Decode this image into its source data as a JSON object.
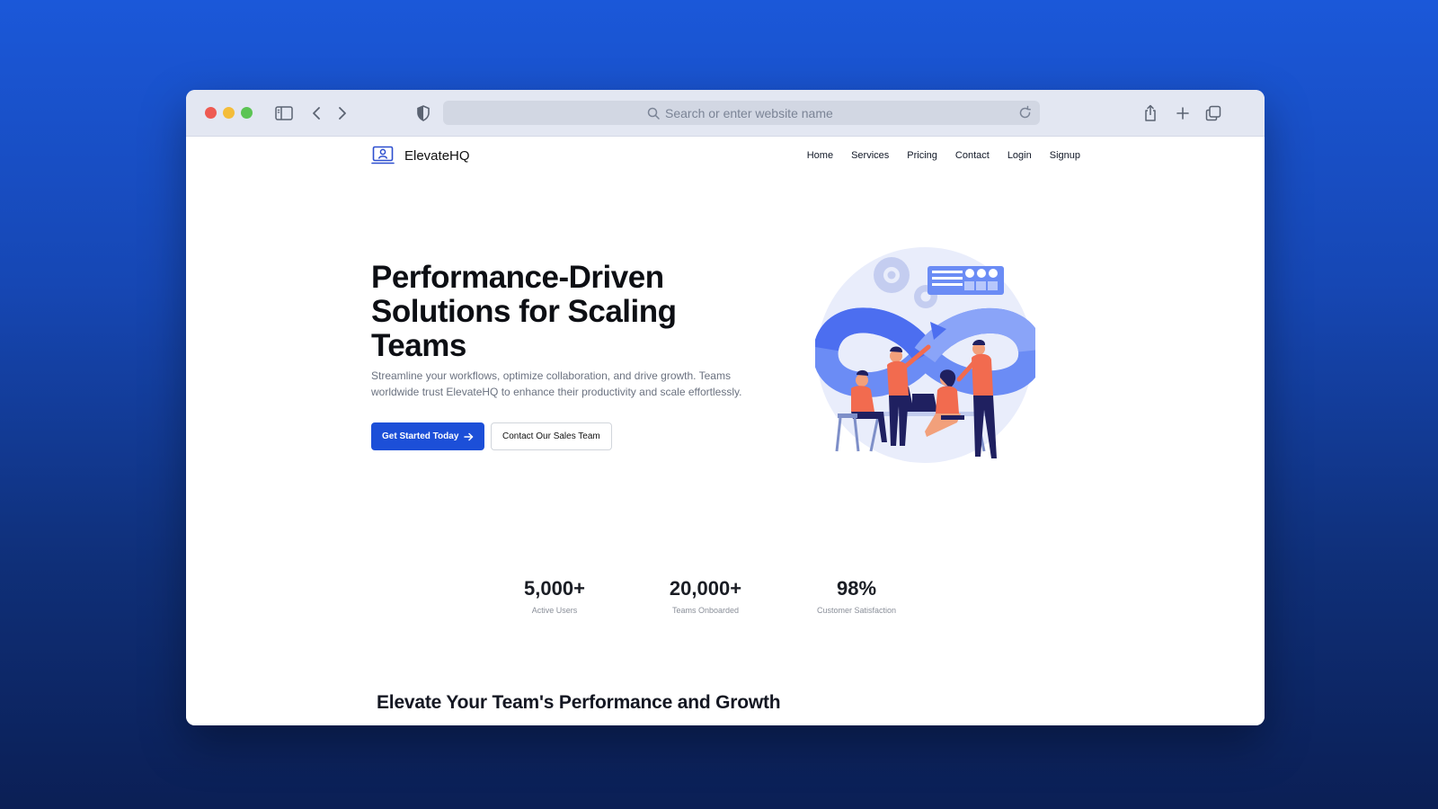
{
  "browser": {
    "url_placeholder": "Search or enter website name"
  },
  "site": {
    "brand": "ElevateHQ",
    "nav": [
      "Home",
      "Services",
      "Pricing",
      "Contact",
      "Login",
      "Signup"
    ]
  },
  "hero": {
    "title": "Performance-Driven Solutions for Scaling Teams",
    "subtitle": "Streamline your workflows, optimize collaboration, and drive growth. Teams worldwide trust ElevateHQ to enhance their productivity and scale effortlessly.",
    "primary_cta": "Get Started Today",
    "secondary_cta": "Contact Our Sales Team"
  },
  "stats": [
    {
      "value": "5,000+",
      "label": "Active Users"
    },
    {
      "value": "20,000+",
      "label": "Teams Onboarded"
    },
    {
      "value": "98%",
      "label": "Customer Satisfaction"
    }
  ],
  "section": {
    "title": "Elevate Your Team's Performance and Growth"
  },
  "colors": {
    "accent": "#1c4fd8",
    "illustration_blue": "#6b8cf5",
    "illustration_orange": "#f26b4f",
    "background_top": "#1b58d9",
    "background_bottom": "#0b1f55"
  },
  "icons": [
    "sidebar-toggle-icon",
    "back-arrow-icon",
    "forward-arrow-icon",
    "shield-icon",
    "search-icon",
    "reload-icon",
    "share-icon",
    "new-tab-icon",
    "tabs-overview-icon",
    "logo-icon",
    "arrow-right-icon"
  ]
}
